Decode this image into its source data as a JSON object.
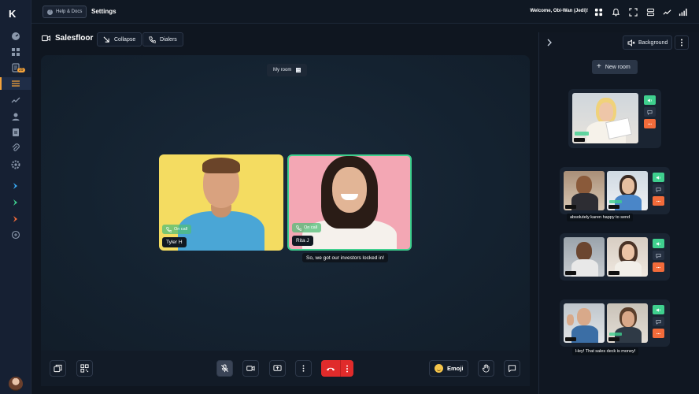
{
  "topbar": {
    "help_label": "Help & Docs",
    "settings_label": "Settings",
    "welcome": "Welcome, Obi-Wan (Jedi)!"
  },
  "rail": {
    "logo": "K",
    "badge": "29"
  },
  "room": {
    "title": "Salesfloor",
    "collapse_label": "Collapse",
    "dialers_label": "Dialers",
    "myroom_label": "My room"
  },
  "tiles": [
    {
      "name": "Tyler H",
      "status": "On call"
    },
    {
      "name": "Rita J",
      "status": "On call"
    }
  ],
  "caption": "So, we got our investors locked in!",
  "controls": {
    "emoji_label": "Emoji"
  },
  "panel": {
    "background_label": "Background",
    "new_room_label": "New room",
    "rooms": [
      {
        "caption": ""
      },
      {
        "caption": "absolutely karen happy to send"
      },
      {
        "caption": ""
      },
      {
        "caption": "Hey! That sales deck is money!"
      }
    ]
  },
  "colors": {
    "accent": "#f4a23b",
    "oncall": "#3fcf8e",
    "end_call": "#e02b2b",
    "hangup_orange": "#f26b3a"
  }
}
